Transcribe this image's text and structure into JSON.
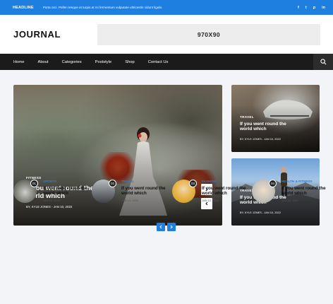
{
  "topbar": {
    "headline_label": "HEADLINE",
    "ticker_text": "Porta orci. Pellen tesque at turpis at mi fermentum vulputate ultricestin cidunt ligula.",
    "socials": [
      "f",
      "t",
      "p",
      "in"
    ]
  },
  "header": {
    "logo": "JOURNAL",
    "ad_text": "970X90"
  },
  "nav": {
    "items": [
      "Home",
      "About",
      "Categories",
      "Poststyle",
      "Shop",
      "Contact Us"
    ],
    "search_icon": "search-icon"
  },
  "featured": {
    "big": {
      "category": "FITNESS",
      "title": "If you went round the world which",
      "meta": "BY, KYLE JONES - JAN 10, 2022"
    },
    "side": [
      {
        "category": "TRAVEL",
        "title": "If you went round the world which",
        "meta": "BY, KYLE JONES - JAN 10, 2022"
      },
      {
        "category": "TRAVEL",
        "title": "If you went round the world which",
        "meta": "BY, KYLE JONES - JAN 10, 2022"
      }
    ]
  },
  "strip": [
    {
      "num": "01",
      "category": "SPORTS",
      "title": "If you went round the world which",
      "date": "JAN 10, 2022"
    },
    {
      "num": "02",
      "category": "TRAVEL",
      "title": "If you went round the world which",
      "date": "JAN 10, 2022"
    },
    {
      "num": "03",
      "category": "FASHION",
      "title": "If you went round the world which",
      "date": "JAN 10, 2022"
    },
    {
      "num": "04",
      "category": "HEALTH & FITNESS",
      "title": "If you went round the world which",
      "date": "JAN 10, 2022"
    }
  ],
  "colors": {
    "accent": "#1e7fe0",
    "nav_bg": "#1b1b1b"
  }
}
